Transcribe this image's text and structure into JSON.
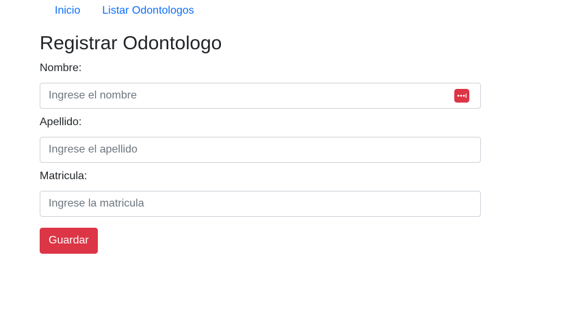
{
  "nav": {
    "links": [
      {
        "label": "Inicio"
      },
      {
        "label": "Listar Odontologos"
      }
    ]
  },
  "page": {
    "title": "Registrar Odontologo"
  },
  "form": {
    "fields": [
      {
        "label": "Nombre:",
        "placeholder": "Ingrese el nombre",
        "value": ""
      },
      {
        "label": "Apellido:",
        "placeholder": "Ingrese el apellido",
        "value": ""
      },
      {
        "label": "Matricula:",
        "placeholder": "Ingrese la matricula",
        "value": ""
      }
    ],
    "submit_label": "Guardar"
  },
  "icons": {
    "password_manager": "password-manager-icon"
  },
  "colors": {
    "link": "#0d6efd",
    "danger": "#dc3545",
    "border": "#ced4da"
  }
}
